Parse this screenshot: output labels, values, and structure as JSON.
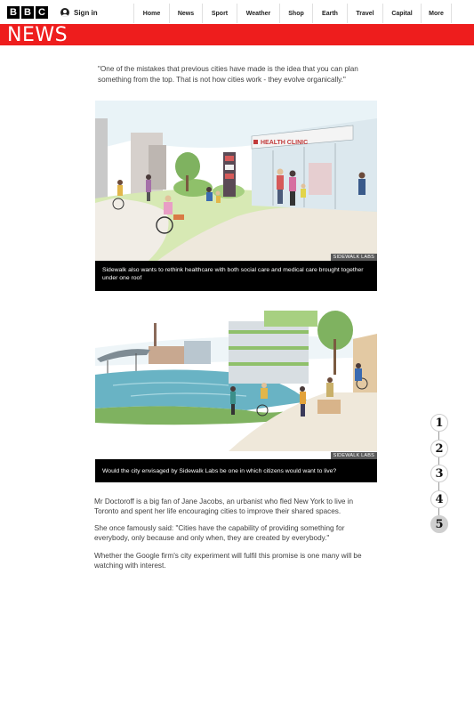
{
  "header": {
    "logo_letters": [
      "B",
      "B",
      "C"
    ],
    "sign_in": "Sign in",
    "nav": [
      {
        "label": "Home",
        "w": 40
      },
      {
        "label": "News",
        "w": 37
      },
      {
        "label": "Sport",
        "w": 39
      },
      {
        "label": "Weather",
        "w": 48
      },
      {
        "label": "Shop",
        "w": 37
      },
      {
        "label": "Earth",
        "w": 39
      },
      {
        "label": "Travel",
        "w": 40
      },
      {
        "label": "Capital",
        "w": 43
      },
      {
        "label": "More",
        "w": 35
      }
    ],
    "section": "NEWS"
  },
  "article": {
    "quote": "\"One of the mistakes that previous cities have made is the idea that you can plan something from the top. That is not how cities work - they evolve organically.\"",
    "figure1": {
      "credit": "SIDEWALK LABS",
      "sign_text": "HEALTH CLINIC",
      "caption": "Sidewalk also wants to rethink healthcare with both social care and medical care brought together under one roof"
    },
    "figure2": {
      "credit": "SIDEWALK LABS",
      "caption": "Would the city envisaged by Sidewalk Labs be one in which citizens would want to live?"
    },
    "paragraphs": [
      "Mr Doctoroff is a big fan of Jane Jacobs, an urbanist who fled New York to live in Toronto and spent her life encouraging cities to improve their shared spaces.",
      "She once famously said: \"Cities have the capability of providing something for everybody, only because and only when, they are created by everybody.\"",
      "Whether the Google firm's city experiment will fulfil this promise is one many will be watching with interest."
    ]
  },
  "pager": {
    "pages": [
      "1",
      "2",
      "3",
      "4",
      "5"
    ],
    "active_index": 4
  },
  "colors": {
    "brand_red": "#ee1d1d",
    "caption_bg": "#000000",
    "credit_bg": "#5a5a5a"
  }
}
